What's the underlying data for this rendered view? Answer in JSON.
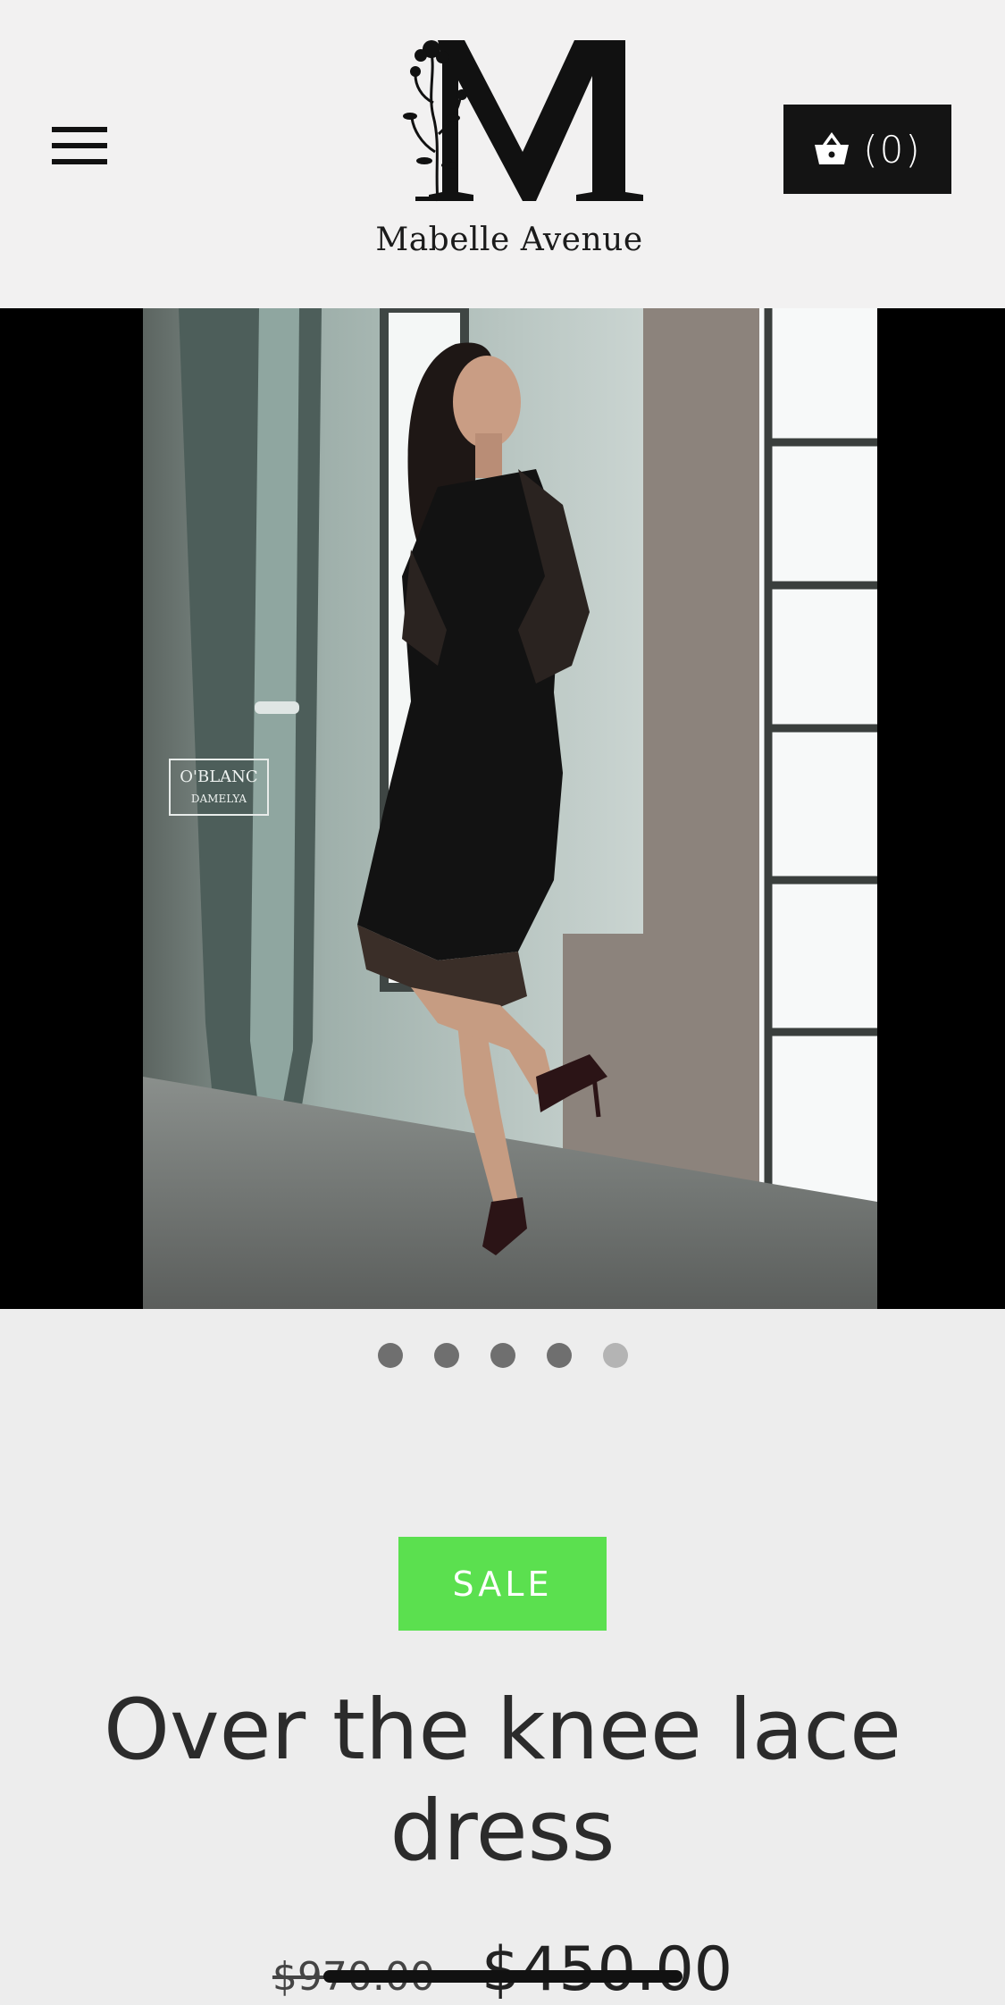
{
  "header": {
    "menu_icon": "hamburger-menu-icon",
    "logo": {
      "monogram": "M",
      "name": "Mabelle Avenue"
    },
    "cart": {
      "icon": "basket-icon",
      "count_label": "(0)"
    }
  },
  "hero": {
    "image_alt": "Model wearing black over the knee lace dress with long lace sleeves, posing by a window",
    "watermark": {
      "line1": "O'BLANC",
      "line2": "DAMELYA"
    },
    "slide_count": 5,
    "active_slide": 5
  },
  "product": {
    "badge": "SALE",
    "title": "Over the knee lace dress",
    "compare_at_price": "$970.00",
    "price": "$450.00"
  },
  "colors": {
    "page_bg": "#ededed",
    "header_bg": "#f2f1f1",
    "cart_bg": "#141414",
    "sale_green": "#5be04f",
    "dot_active": "#6f6f6f",
    "dot_inactive": "#b4b4b4"
  }
}
